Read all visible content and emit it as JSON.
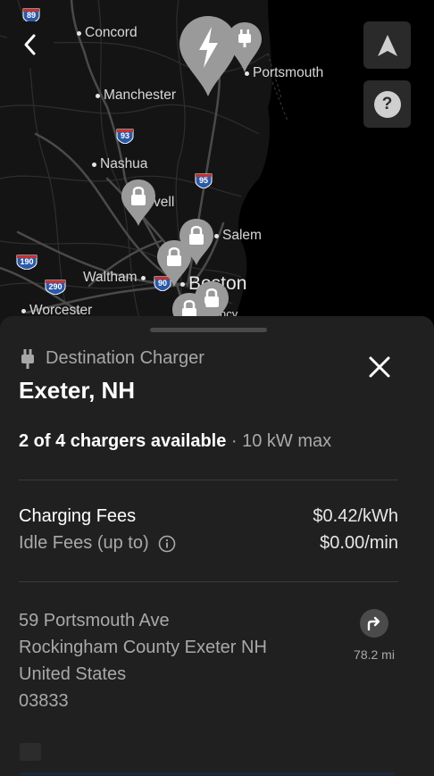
{
  "map": {
    "cities": [
      {
        "name": "Concord"
      },
      {
        "name": "Manchester"
      },
      {
        "name": "Nashua"
      },
      {
        "name": "Portsmouth"
      },
      {
        "name": "vell"
      },
      {
        "name": "Salem"
      },
      {
        "name": "Waltham"
      },
      {
        "name": "Boston"
      },
      {
        "name": "Worcester"
      },
      {
        "name": "ncy"
      }
    ],
    "shields": [
      "89",
      "93",
      "95",
      "190",
      "290",
      "90"
    ],
    "back_icon": "chevron-left-icon",
    "navigate_icon": "navigation-arrow-icon",
    "help_label": "?"
  },
  "charger": {
    "type": "Destination Charger",
    "name": "Exeter, NH",
    "availability": "2 of 4 chargers available",
    "max_power": " · 10 kW max"
  },
  "fees": {
    "charging_label": "Charging Fees",
    "charging_value": "$0.42/kWh",
    "idle_label": "Idle Fees (up to)",
    "idle_value": "$0.00/min"
  },
  "address": {
    "line1": "59 Portsmouth Ave",
    "line2": "Rockingham County Exeter NH",
    "line3": "United States",
    "line4": "03833",
    "distance": "78.2 mi"
  },
  "colors": {
    "sheet_bg": "#202020",
    "map_bg": "#0d0d0d",
    "pin": "#9a9a9a",
    "text_primary": "#ffffff",
    "text_secondary": "#a9a9a9"
  }
}
